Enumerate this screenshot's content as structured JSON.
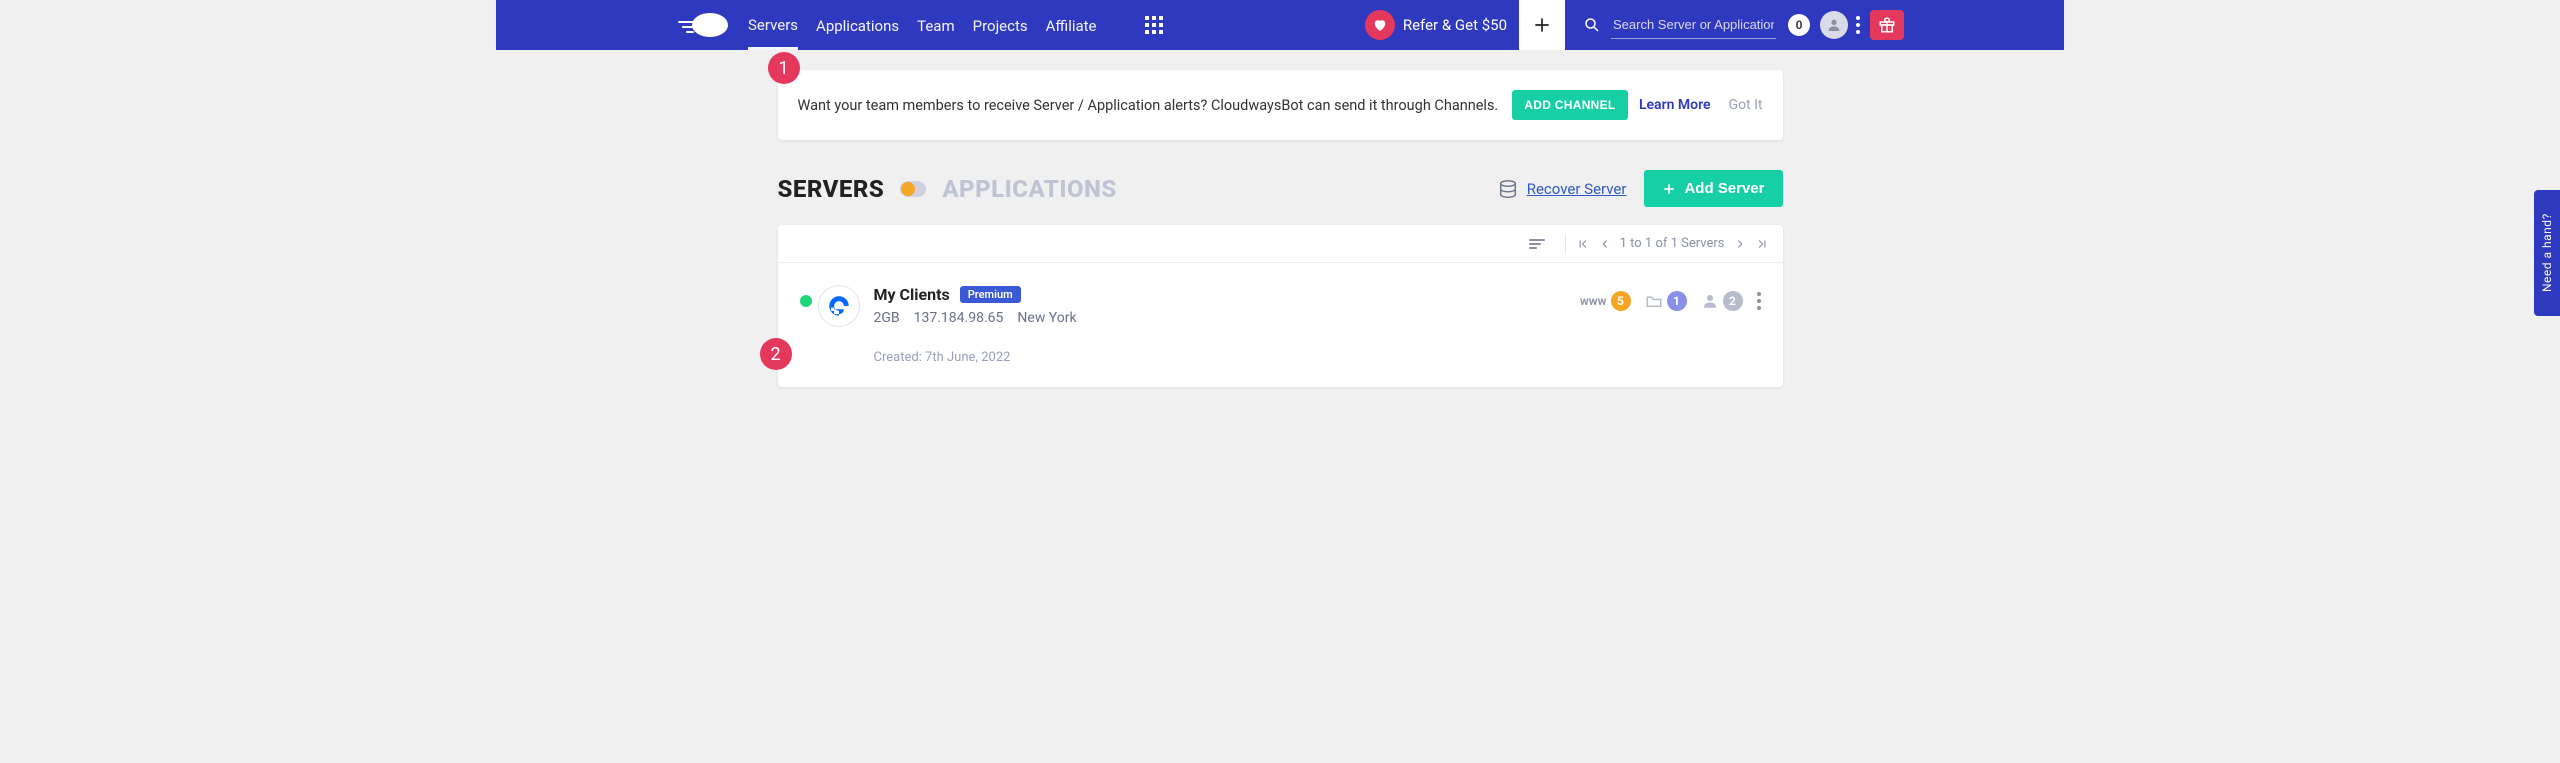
{
  "nav": {
    "links": [
      "Servers",
      "Applications",
      "Team",
      "Projects",
      "Affiliate"
    ],
    "refer_label": "Refer & Get $50",
    "search_placeholder": "Search Server or Application",
    "notif_count": "0"
  },
  "callouts": {
    "one": "1",
    "two": "2"
  },
  "notice": {
    "text": "Want your team members to receive Server / Application alerts? CloudwaysBot can send it through Channels.",
    "add_channel": "ADD CHANNEL",
    "learn_more": "Learn More",
    "got_it": "Got It"
  },
  "tabs": {
    "servers": "SERVERS",
    "applications": "APPLICATIONS",
    "recover": "Recover Server",
    "add_server": "Add Server"
  },
  "list": {
    "pager_text": "1 to 1 of 1 Servers"
  },
  "server": {
    "name": "My Clients",
    "tag": "Premium",
    "size": "2GB",
    "ip": "137.184.98.65",
    "region": "New York",
    "created": "Created: 7th June, 2022",
    "www_label": "www",
    "www_count": "5",
    "proj_count": "1",
    "user_count": "2"
  },
  "help_tab": "Need a hand?"
}
